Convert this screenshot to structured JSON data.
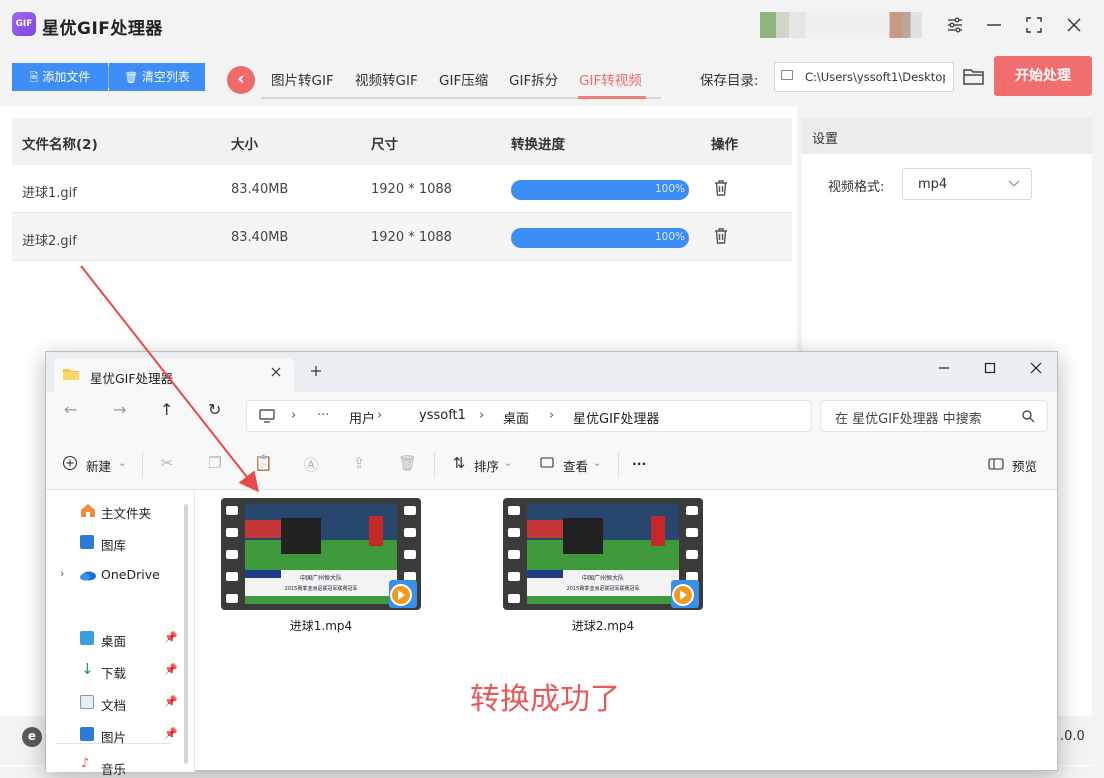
{
  "app": {
    "title": "星优GIF处理器",
    "logo_text": "GIF",
    "accent": "#3f8ef7",
    "danger": "#f26d6d"
  },
  "toolbar": {
    "add_files": "添加文件",
    "clear_list": "清空列表",
    "tabs": [
      "图片转GIF",
      "视频转GIF",
      "GIF压缩",
      "GIF拆分",
      "GIF转视频"
    ],
    "active_tab": "GIF转视频",
    "save_label": "保存目录:",
    "save_path": "C:\\Users\\yssoft1\\Desktop",
    "start": "开始处理"
  },
  "table": {
    "headers": [
      "文件名称(2)",
      "大小",
      "尺寸",
      "转换进度",
      "操作"
    ],
    "rows": [
      {
        "name": "进球1.gif",
        "size": "83.40MB",
        "dims": "1920 * 1088",
        "progress": "100%",
        "progress_value": 1.0
      },
      {
        "name": "进球2.gif",
        "size": "83.40MB",
        "dims": "1920 * 1088",
        "progress": "100%",
        "progress_value": 1.0
      }
    ]
  },
  "settings": {
    "title": "设置",
    "format_label": "视频格式:",
    "format_value": "mp4"
  },
  "footer": {
    "version": ".0.0"
  },
  "explorer": {
    "tab_title": "星优GIF处理器",
    "breadcrumb": [
      "用户",
      "yssoft1",
      "桌面",
      "星优GIF处理器"
    ],
    "search_placeholder": "在 星优GIF处理器 中搜索",
    "commands": {
      "new": "新建",
      "sort": "排序",
      "view": "查看",
      "preview": "预览",
      "more": "···"
    },
    "nav": [
      {
        "label": "主文件夹",
        "icon": "home-icon"
      },
      {
        "label": "图库",
        "icon": "gallery-icon"
      },
      {
        "label": "OneDrive",
        "icon": "cloud-icon"
      },
      {
        "label": "桌面",
        "icon": "desktop-icon",
        "pinned": true
      },
      {
        "label": "下载",
        "icon": "download-icon",
        "pinned": true
      },
      {
        "label": "文档",
        "icon": "document-icon",
        "pinned": true
      },
      {
        "label": "图片",
        "icon": "picture-icon",
        "pinned": true
      },
      {
        "label": "音乐",
        "icon": "music-icon",
        "pinned": true
      }
    ],
    "files": [
      {
        "name": "进球1.mp4",
        "caption": "中国广州恒大队",
        "subcaption": "2015赛季亚洲足联冠军联赛冠军"
      },
      {
        "name": "进球2.mp4",
        "caption": "中国广州恒大队",
        "subcaption": "2015赛季亚洲足联冠军联赛冠军"
      }
    ],
    "success": "转换成功了"
  }
}
